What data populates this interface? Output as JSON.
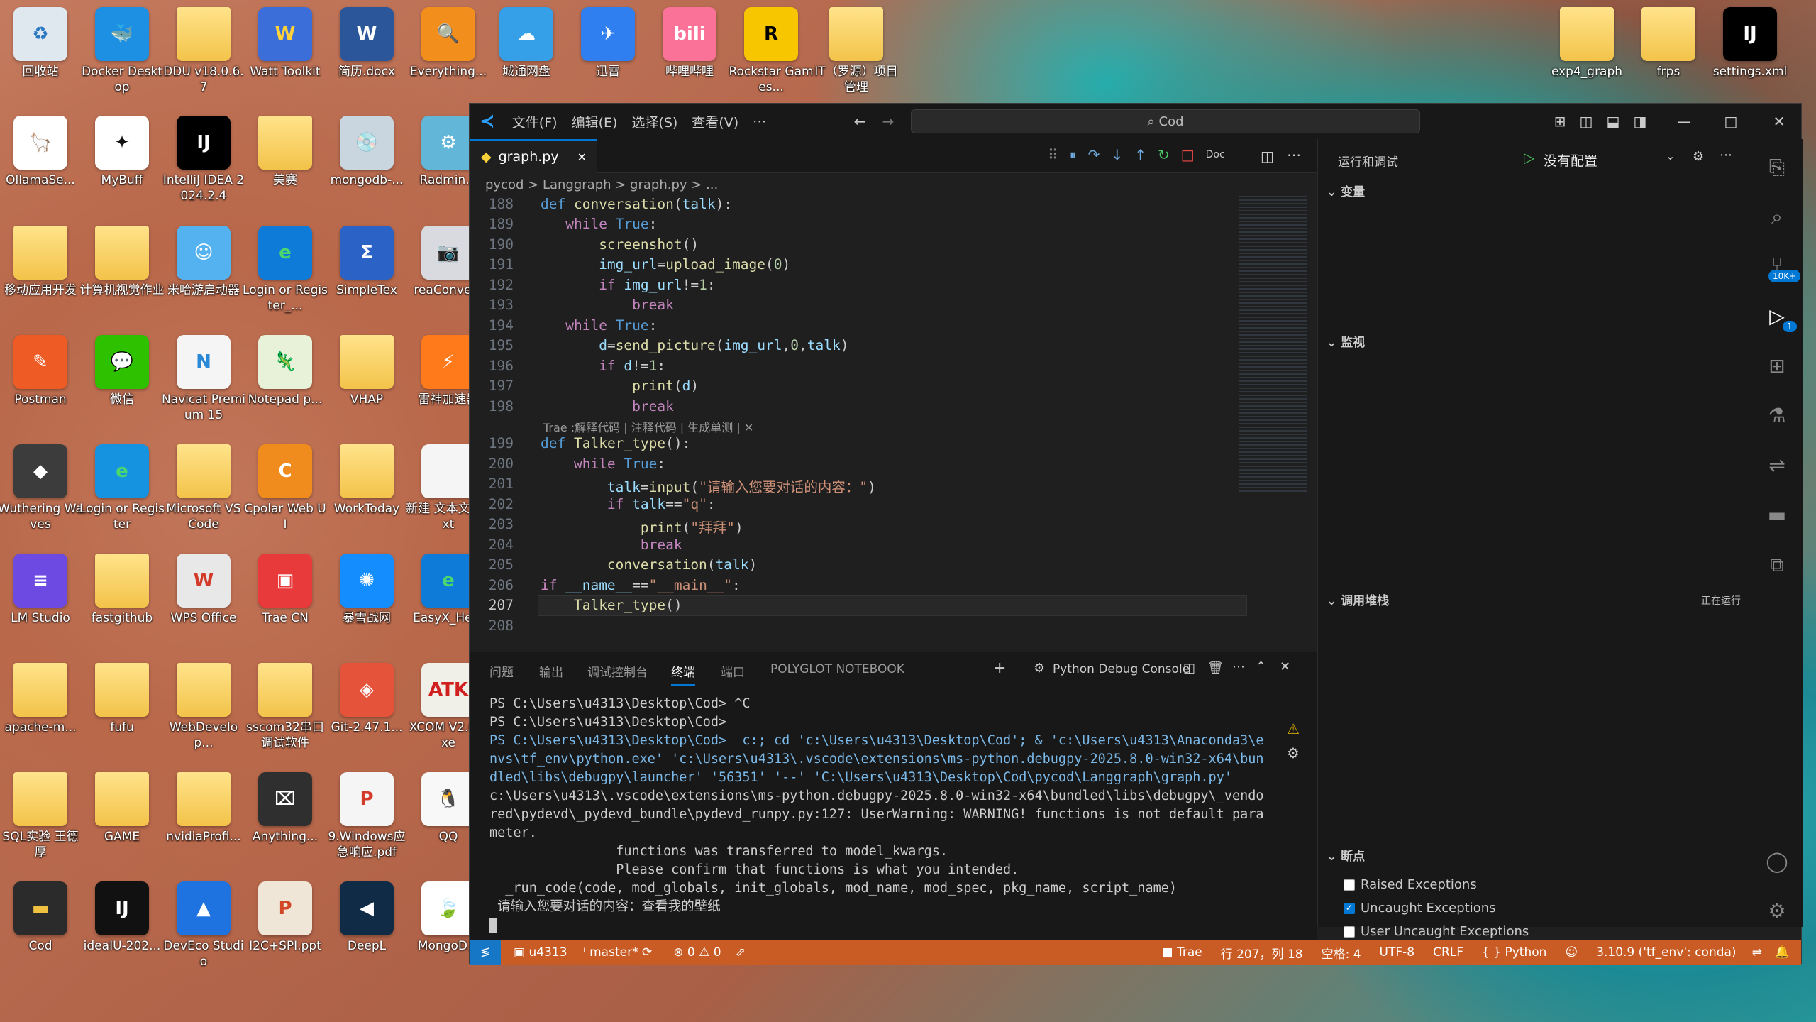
{
  "desktop": {
    "icons": [
      {
        "label": "回收站",
        "glyph": "♻",
        "bg": "#dfe8ef",
        "fg": "#2b78c2"
      },
      {
        "label": "Docker Desktop",
        "glyph": "🐳",
        "bg": "#1d90e4",
        "fg": "#fff"
      },
      {
        "label": "DDU v18.0.6.7",
        "glyph": "",
        "bg": "folder",
        "fg": "#fff"
      },
      {
        "label": "Watt Toolkit",
        "glyph": "W",
        "bg": "#3b6ed8",
        "fg": "#ffd23a"
      },
      {
        "label": "简历.docx",
        "glyph": "W",
        "bg": "#2b579a",
        "fg": "#fff"
      },
      {
        "label": "Everything...",
        "glyph": "🔍",
        "bg": "#f28f1c",
        "fg": "#fff"
      },
      {
        "label": "城通网盘",
        "glyph": "☁",
        "bg": "#35a0e8",
        "fg": "#fff"
      },
      {
        "label": "迅雷",
        "glyph": "✈",
        "bg": "#2f7ff0",
        "fg": "#fff"
      },
      {
        "label": "哔哩哔哩",
        "glyph": "bili",
        "bg": "#fb7299",
        "fg": "#fff"
      },
      {
        "label": "Rockstar Games...",
        "glyph": "R",
        "bg": "#f7c600",
        "fg": "#000"
      },
      {
        "label": "IT（罗源）项目管理",
        "glyph": "",
        "bg": "folder",
        "fg": "#fff"
      },
      {
        "label": "OllamaSe...",
        "glyph": "🦙",
        "bg": "#ffffff",
        "fg": "#000"
      },
      {
        "label": "MyBuff",
        "glyph": "✦",
        "bg": "#ffffff",
        "fg": "#111"
      },
      {
        "label": "IntelliJ IDEA 2024.2.4",
        "glyph": "IJ",
        "bg": "#000000",
        "fg": "#fff"
      },
      {
        "label": "美赛",
        "glyph": "",
        "bg": "folder",
        "fg": "#fff"
      },
      {
        "label": "mongodb-...",
        "glyph": "💿",
        "bg": "#c9d6df",
        "fg": "#333"
      },
      {
        "label": "Radmin...",
        "glyph": "⚙",
        "bg": "#62b6d8",
        "fg": "#fff"
      },
      {
        "label": "移动应用开发",
        "glyph": "",
        "bg": "folder",
        "fg": "#fff"
      },
      {
        "label": "计算机视觉作业",
        "glyph": "",
        "bg": "folder",
        "fg": "#fff"
      },
      {
        "label": "米哈游启动器",
        "glyph": "☺",
        "bg": "#55b2f0",
        "fg": "#fff"
      },
      {
        "label": "Login or Register_...",
        "glyph": "e",
        "bg": "#0f7bd8",
        "fg": "#4bd66e"
      },
      {
        "label": "SimpleTex",
        "glyph": "Σ",
        "bg": "#2a63c5",
        "fg": "#fff"
      },
      {
        "label": "reaConve...",
        "glyph": "📷",
        "bg": "#d8dadf",
        "fg": "#333"
      },
      {
        "label": "Postman",
        "glyph": "✎",
        "bg": "#ef5b25",
        "fg": "#fff"
      },
      {
        "label": "微信",
        "glyph": "💬",
        "bg": "#2dc100",
        "fg": "#fff"
      },
      {
        "label": "Navicat Premium 15",
        "glyph": "N",
        "bg": "#f5f5f5",
        "fg": "#2a89d6"
      },
      {
        "label": "Notepad p...",
        "glyph": "🦎",
        "bg": "#e8f2d8",
        "fg": "#4a8a2a"
      },
      {
        "label": "VHAP",
        "glyph": "",
        "bg": "folder",
        "fg": "#fff"
      },
      {
        "label": "雷神加速器",
        "glyph": "⚡",
        "bg": "#ff7a1a",
        "fg": "#fff"
      },
      {
        "label": "Wuthering Waves",
        "glyph": "◆",
        "bg": "#3c3c3c",
        "fg": "#fff"
      },
      {
        "label": "Login or Register",
        "glyph": "e",
        "bg": "#1593e0",
        "fg": "#4bd66e"
      },
      {
        "label": "Microsoft VS Code",
        "glyph": "",
        "bg": "folder",
        "fg": "#fff"
      },
      {
        "label": "Cpolar Web UI",
        "glyph": "C",
        "bg": "#f08b1e",
        "fg": "#fff"
      },
      {
        "label": "WorkToday",
        "glyph": "",
        "bg": "folder",
        "fg": "#fff"
      },
      {
        "label": "新建 文本文档.txt",
        "glyph": "",
        "bg": "#f5f5f5",
        "fg": "#333"
      },
      {
        "label": "LM Studio",
        "glyph": "≡",
        "bg": "#6d4be3",
        "fg": "#fff"
      },
      {
        "label": "fastgithub",
        "glyph": "",
        "bg": "folder",
        "fg": "#fff"
      },
      {
        "label": "WPS Office",
        "glyph": "W",
        "bg": "#e8e8e8",
        "fg": "#d33a2a"
      },
      {
        "label": "Trae CN",
        "glyph": "▣",
        "bg": "#e83a3a",
        "fg": "#fff"
      },
      {
        "label": "暴雪战网",
        "glyph": "✺",
        "bg": "#148eff",
        "fg": "#fff"
      },
      {
        "label": "EasyX_He...",
        "glyph": "e",
        "bg": "#0f7bd8",
        "fg": "#4bd66e"
      },
      {
        "label": "apache-m...",
        "glyph": "",
        "bg": "folder",
        "fg": "#fff"
      },
      {
        "label": "fufu",
        "glyph": "",
        "bg": "folder",
        "fg": "#fff"
      },
      {
        "label": "WebDevelop...",
        "glyph": "",
        "bg": "folder",
        "fg": "#fff"
      },
      {
        "label": "sscom32串口调试软件",
        "glyph": "",
        "bg": "folder",
        "fg": "#fff"
      },
      {
        "label": "Git-2.47.1...",
        "glyph": "◈",
        "bg": "#e5533b",
        "fg": "#fff"
      },
      {
        "label": "XCOM V2.0.exe",
        "glyph": "ATK",
        "bg": "#f0efe8",
        "fg": "#d01f1f"
      },
      {
        "label": "SQL实验 王德厚",
        "glyph": "",
        "bg": "folder",
        "fg": "#fff"
      },
      {
        "label": "GAME",
        "glyph": "",
        "bg": "folder",
        "fg": "#fff"
      },
      {
        "label": "nvidiaProfi...",
        "glyph": "",
        "bg": "folder",
        "fg": "#fff"
      },
      {
        "label": "Anything...",
        "glyph": "⌧",
        "bg": "#2f2f2f",
        "fg": "#fff"
      },
      {
        "label": "9.Windows应急响应.pdf",
        "glyph": "P",
        "bg": "#f5f5f5",
        "fg": "#d33a2a"
      },
      {
        "label": "QQ",
        "glyph": "🐧",
        "bg": "#f8f8f8",
        "fg": "#000"
      },
      {
        "label": "Cod",
        "glyph": "▬",
        "bg": "#2b2b2b",
        "fg": "#f0c040"
      },
      {
        "label": "ideaIU-202...",
        "glyph": "IJ",
        "bg": "#111111",
        "fg": "#fff"
      },
      {
        "label": "DevEco Studio",
        "glyph": "▲",
        "bg": "#1e73e0",
        "fg": "#fff"
      },
      {
        "label": "I2C+SPI.ppt",
        "glyph": "P",
        "bg": "#f0e6d8",
        "fg": "#d24726"
      },
      {
        "label": "DeepL",
        "glyph": "◀",
        "bg": "#0f2b46",
        "fg": "#fff"
      },
      {
        "label": "MongoD...",
        "glyph": "🍃",
        "bg": "#ffffff",
        "fg": "#3fa037"
      },
      {
        "label": "exp4_graph",
        "glyph": "",
        "bg": "folder",
        "fg": "#fff"
      },
      {
        "label": "frps",
        "glyph": "",
        "bg": "folder",
        "fg": "#fff"
      },
      {
        "label": "settings.xml",
        "glyph": "IJ",
        "bg": "#000000",
        "fg": "#fff"
      }
    ]
  },
  "vscode": {
    "menu": [
      "文件(F)",
      "编辑(E)",
      "选择(S)",
      "查看(V)",
      "⋯"
    ],
    "search_text": "Cod",
    "tab": {
      "name": "graph.py",
      "close": "✕"
    },
    "breadcrumb": "pycod > Langgraph > graph.py > ...",
    "codelens": "Trae :解释代码 | 注释代码 | 生成单测 | ✕",
    "debug_toolbar": "Doc",
    "panel_tabs": [
      "问题",
      "输出",
      "调试控制台",
      "终端",
      "端口",
      "POLYGLOT NOTEBOOK"
    ],
    "panel_active": "终端",
    "panel_console": "Python Debug Console",
    "terminal_lines": [
      "PS C:\\Users\\u4313\\Desktop\\Cod> ^C",
      "PS C:\\Users\\u4313\\Desktop\\Cod>",
      "PS C:\\Users\\u4313\\Desktop\\Cod>  c:; cd 'c:\\Users\\u4313\\Desktop\\Cod'; & 'c:\\Users\\u4313\\Anaconda3\\e",
      "nvs\\tf_env\\python.exe' 'c:\\Users\\u4313\\.vscode\\extensions\\ms-python.debugpy-2025.8.0-win32-x64\\bun",
      "dled\\libs\\debugpy\\launcher' '56351' '--' 'C:\\Users\\u4313\\Desktop\\Cod\\pycod\\Langgraph\\graph.py'",
      "c:\\Users\\u4313\\.vscode\\extensions\\ms-python.debugpy-2025.8.0-win32-x64\\bundled\\libs\\debugpy\\_vendo",
      "red\\pydevd\\_pydevd_bundle\\pydevd_runpy.py:127: UserWarning: WARNING! functions is not default para",
      "meter.",
      "                functions was transferred to model_kwargs.",
      "                Please confirm that functions is what you intended.",
      "  _run_code(code, mod_globals, init_globals, mod_name, mod_spec, pkg_name, script_name)",
      " 请输入您要对话的内容：查看我的壁纸"
    ],
    "side": {
      "title": "运行和调试",
      "config": "没有配置",
      "sections": {
        "vars": "变量",
        "watch": "监视",
        "callstack": "调用堆栈",
        "callstack_status": "正在运行",
        "breakpoints": "断点"
      },
      "breakpoints": [
        {
          "label": "Raised Exceptions",
          "checked": false
        },
        {
          "label": "Uncaught Exceptions",
          "checked": true
        },
        {
          "label": "User Uncaught Exceptions",
          "checked": false
        }
      ]
    },
    "activity_badge_1": "10K+",
    "activity_badge_2": "1",
    "status": {
      "user": "u4313",
      "branch": "master*",
      "errors": "0",
      "warnings": "0",
      "trae": "Trae",
      "position": "行 207，列 18",
      "spaces": "空格: 4",
      "encoding": "UTF-8",
      "eol": "CRLF",
      "lang": "Python",
      "interpreter": "3.10.9 ('tf_env': conda)"
    },
    "code_lines": [
      {
        "n": "188"
      },
      {
        "n": "189"
      },
      {
        "n": "190"
      },
      {
        "n": "191"
      },
      {
        "n": "192"
      },
      {
        "n": "193"
      },
      {
        "n": "194"
      },
      {
        "n": "195"
      },
      {
        "n": "196"
      },
      {
        "n": "197"
      },
      {
        "n": "198"
      },
      {
        "n": "199"
      },
      {
        "n": "200"
      },
      {
        "n": "201"
      },
      {
        "n": "202"
      },
      {
        "n": "203"
      },
      {
        "n": "204"
      },
      {
        "n": "205"
      },
      {
        "n": "206"
      },
      {
        "n": "207"
      },
      {
        "n": "208"
      }
    ]
  }
}
